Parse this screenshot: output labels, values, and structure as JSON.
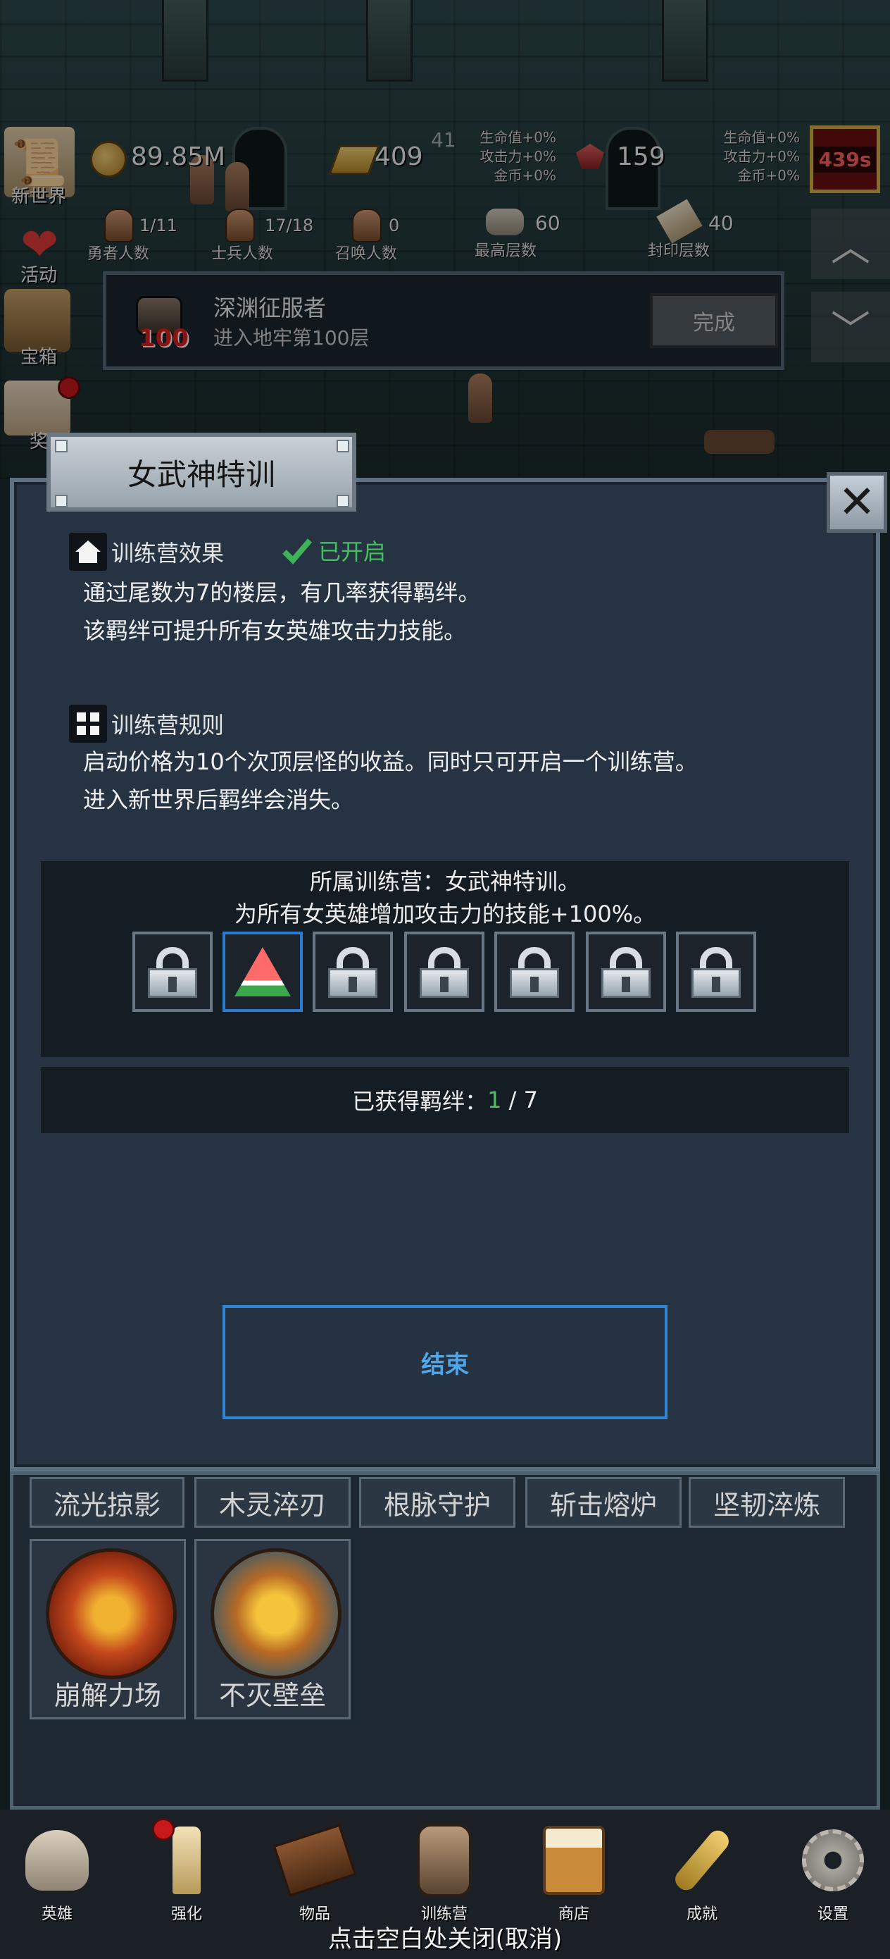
{
  "hud": {
    "left_menu": [
      {
        "label": "新世界",
        "icon": "scroll-icon"
      },
      {
        "label": "活动",
        "icon": "heart-icon"
      },
      {
        "label": "宝箱",
        "icon": "chest-icon"
      },
      {
        "label": "奖",
        "icon": "letter-icon"
      }
    ],
    "gold": "89.85M",
    "gold_bar": "409",
    "gold_bar_small": "41",
    "bonus_left": [
      "生命值+0%",
      "攻击力+0%",
      "金币+0%"
    ],
    "gem": "159",
    "bonus_right": [
      "生命值+0%",
      "攻击力+0%",
      "金币+0%"
    ],
    "timer": "439s",
    "stats": [
      {
        "value": "1/11",
        "label": "勇者人数"
      },
      {
        "value": "17/18",
        "label": "士兵人数"
      },
      {
        "value": "0",
        "label": "召唤人数"
      },
      {
        "value": "60",
        "label": "最高层数"
      },
      {
        "value": "40",
        "label": "封印层数"
      }
    ]
  },
  "achievement": {
    "badge": "100",
    "title": "深渊征服者",
    "desc": "进入地牢第100层",
    "button": "完成"
  },
  "modal": {
    "title": "女武神特训",
    "effect_title": "训练营效果",
    "effect_status": "已开启",
    "effect_lines": [
      "通过尾数为7的楼层，有几率获得羁绊。",
      "该羁绊可提升所有女英雄攻击力技能。"
    ],
    "rules_title": "训练营规则",
    "rules_lines": [
      "启动价格为10个次顶层怪的收益。同时只可开启一个训练营。",
      "进入新世界后羁绊会消失。"
    ],
    "bond_line1": "所属训练营：女武神特训。",
    "bond_line2": "为所有女英雄增加攻击力的技能+100%。",
    "slots": [
      "lock-icon",
      "watermelon-icon",
      "lock-icon",
      "lock-icon",
      "lock-icon",
      "lock-icon",
      "lock-icon"
    ],
    "obtained_label": "已获得羁绊：",
    "obtained_count": "1",
    "obtained_sep": " / ",
    "obtained_total": "7",
    "end_button": "结束"
  },
  "skills": {
    "tabs": [
      "流光掠影",
      "木灵淬刃",
      "根脉守护",
      "斩击熔炉",
      "坚韧淬炼"
    ],
    "cards": [
      {
        "name": "崩解力场",
        "color": "#c4481c"
      },
      {
        "name": "不灭壁垒",
        "color": "#b86a24"
      }
    ]
  },
  "bottom_nav": [
    {
      "label": "英雄",
      "icon": "skull-icon"
    },
    {
      "label": "强化",
      "icon": "candle-icon"
    },
    {
      "label": "物品",
      "icon": "book-icon"
    },
    {
      "label": "训练营",
      "icon": "lantern-icon"
    },
    {
      "label": "商店",
      "icon": "beer-mug-icon"
    },
    {
      "label": "成就",
      "icon": "key-icon"
    },
    {
      "label": "设置",
      "icon": "gear-icon"
    }
  ],
  "close_hint": "点击空白处关闭(取消)"
}
